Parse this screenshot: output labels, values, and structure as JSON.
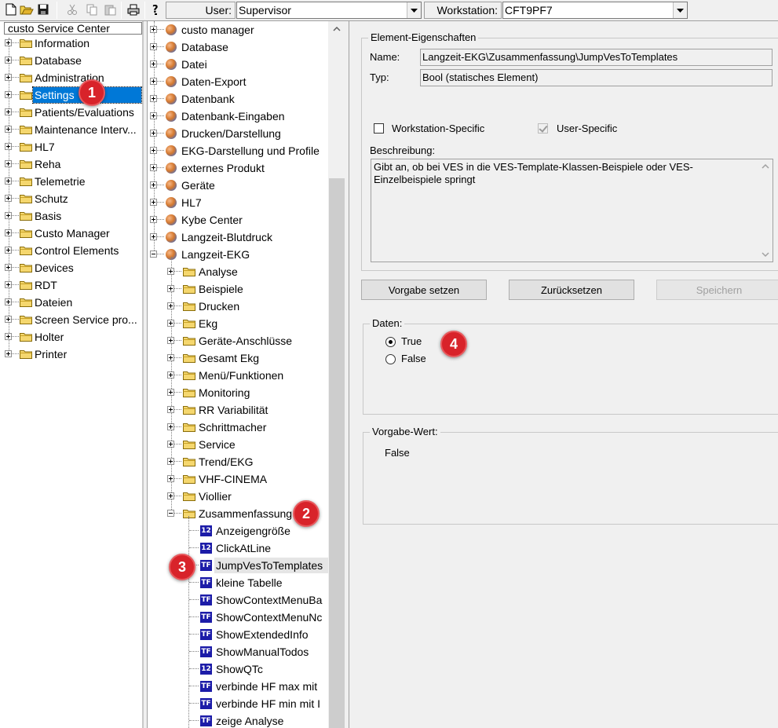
{
  "toolbar": {
    "user_label": "User:",
    "user_value": "Supervisor",
    "workstation_label": "Workstation:",
    "workstation_value": "CFT9PF7",
    "icons": [
      "new-icon",
      "open-icon",
      "save-icon",
      "cut-icon",
      "copy-icon",
      "paste-icon",
      "print-icon",
      "help-icon"
    ]
  },
  "left_tree": {
    "header": "custo Service Center",
    "items": [
      {
        "label": "Information"
      },
      {
        "label": "Database"
      },
      {
        "label": "Administration"
      },
      {
        "label": "Settings",
        "selected": true
      },
      {
        "label": "Patients/Evaluations"
      },
      {
        "label": "Maintenance Interv..."
      },
      {
        "label": "HL7"
      },
      {
        "label": "Reha"
      },
      {
        "label": "Telemetrie"
      },
      {
        "label": "Schutz"
      },
      {
        "label": "Basis"
      },
      {
        "label": "Custo Manager"
      },
      {
        "label": "Control Elements"
      },
      {
        "label": "Devices"
      },
      {
        "label": "RDT"
      },
      {
        "label": "Dateien"
      },
      {
        "label": "Screen Service pro..."
      },
      {
        "label": "Holter"
      },
      {
        "label": "Printer"
      }
    ]
  },
  "mid_tree": {
    "top": [
      "custo manager",
      "Database",
      "Datei",
      "Daten-Export",
      "Datenbank",
      "Datenbank-Eingaben",
      "Drucken/Darstellung",
      "EKG-Darstellung und Profile",
      "externes Produkt",
      "Geräte",
      "HL7",
      "Kybe Center",
      "Langzeit-Blutdruck",
      "Langzeit-EKG"
    ],
    "sub": [
      "Analyse",
      "Beispiele",
      "Drucken",
      "Ekg",
      "Geräte-Anschlüsse",
      "Gesamt Ekg",
      "Menü/Funktionen",
      "Monitoring",
      "RR Variabilität",
      "Schrittmacher",
      "Service",
      "Trend/EKG",
      "VHF-CINEMA",
      "Viollier",
      "Zusammenfassung"
    ],
    "leaves": [
      {
        "icon": "12",
        "label": "Anzeigengröße"
      },
      {
        "icon": "12",
        "label": "ClickAtLine"
      },
      {
        "icon": "TF",
        "label": "JumpVesToTemplates"
      },
      {
        "icon": "TF",
        "label": "kleine Tabelle"
      },
      {
        "icon": "TF",
        "label": "ShowContextMenuBa"
      },
      {
        "icon": "TF",
        "label": "ShowContextMenuNc"
      },
      {
        "icon": "TF",
        "label": "ShowExtendedInfo"
      },
      {
        "icon": "TF",
        "label": "ShowManualTodos"
      },
      {
        "icon": "12",
        "label": "ShowQTc"
      },
      {
        "icon": "TF",
        "label": "verbinde HF max mit"
      },
      {
        "icon": "TF",
        "label": "verbinde HF min mit I"
      },
      {
        "icon": "TF",
        "label": "zeige Analyse"
      }
    ]
  },
  "properties": {
    "group_title": "Element-Eigenschaften",
    "name_label": "Name:",
    "name_value": "Langzeit-EKG\\Zusammenfassung\\JumpVesToTemplates",
    "type_label": "Typ:",
    "type_value": "Bool (statisches Element)",
    "workstation_specific": "Workstation-Specific",
    "user_specific": "User-Specific",
    "description_label": "Beschreibung:",
    "description_text": "Gibt an, ob bei VES in die VES-Template-Klassen-Beispiele oder VES-Einzelbeispiele springt"
  },
  "buttons": {
    "set_default": "Vorgabe setzen",
    "reset": "Zurücksetzen",
    "save": "Speichern"
  },
  "data_group": {
    "title": "Daten:",
    "option_true": "True",
    "option_false": "False",
    "selected": "True"
  },
  "default_group": {
    "title": "Vorgabe-Wert:",
    "value": "False"
  },
  "badges": [
    "1",
    "2",
    "3",
    "4"
  ],
  "colors": {
    "selection": "#0078d7",
    "badge": "#d8232a",
    "leaf_icon": "#1c1ca8"
  }
}
